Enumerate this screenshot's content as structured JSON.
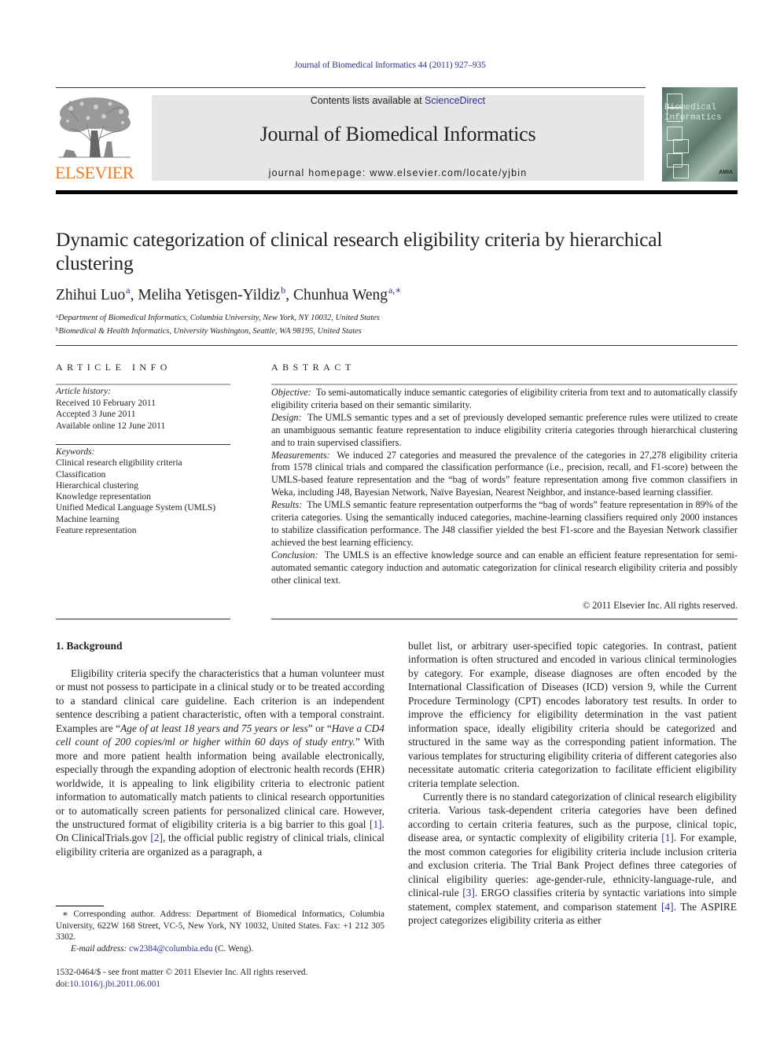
{
  "running_head": "Journal of Biomedical Informatics 44 (2011) 927–935",
  "masthead": {
    "publisher_wordmark": "ELSEVIER",
    "contents_prefix": "Contents lists available at ",
    "contents_link": "ScienceDirect",
    "journal_name": "Journal of Biomedical Informatics",
    "homepage_label": "journal homepage: ",
    "homepage_url": "www.elsevier.com/locate/yjbin",
    "cover_title_line1": "Biomedical",
    "cover_title_line2": "Informatics",
    "cover_publisher": "AMIA"
  },
  "article": {
    "title": "Dynamic categorization of clinical research eligibility criteria by hierarchical clustering",
    "authors": [
      {
        "name": "Zhihui Luo",
        "sup": "a",
        "sep": ", "
      },
      {
        "name": "Meliha Yetisgen-Yildiz",
        "sup": "b",
        "sep": ", "
      },
      {
        "name": "Chunhua Weng",
        "sup": "a,∗",
        "sep": ""
      }
    ],
    "affiliations": [
      {
        "mark": "a",
        "text": "Department of Biomedical Informatics, Columbia University, New York, NY 10032, United States"
      },
      {
        "mark": "b",
        "text": "Biomedical & Health Informatics, University Washington, Seattle, WA 98195, United States"
      }
    ]
  },
  "article_info": {
    "heading": "ARTICLE INFO",
    "history_label": "Article history:",
    "history": [
      "Received 10 February 2011",
      "Accepted 3 June 2011",
      "Available online 12 June 2011"
    ],
    "keywords_label": "Keywords:",
    "keywords": [
      "Clinical research eligibility criteria",
      "Classification",
      "Hierarchical clustering",
      "Knowledge representation",
      "Unified Medical Language System (UMLS)",
      "Machine learning",
      "Feature representation"
    ]
  },
  "abstract": {
    "heading": "ABSTRACT",
    "sections": [
      {
        "label": "Objective:",
        "text": "To semi-automatically induce semantic categories of eligibility criteria from text and to automatically classify eligibility criteria based on their semantic similarity."
      },
      {
        "label": "Design:",
        "text": "The UMLS semantic types and a set of previously developed semantic preference rules were utilized to create an unambiguous semantic feature representation to induce eligibility criteria categories through hierarchical clustering and to train supervised classifiers."
      },
      {
        "label": "Measurements:",
        "text": "We induced 27 categories and measured the prevalence of the categories in 27,278 eligibility criteria from 1578 clinical trials and compared the classification performance (i.e., precision, recall, and F1-score) between the UMLS-based feature representation and the “bag of words” feature representation among five common classifiers in Weka, including J48, Bayesian Network, Naïve Bayesian, Nearest Neighbor, and instance-based learning classifier."
      },
      {
        "label": "Results:",
        "text": "The UMLS semantic feature representation outperforms the “bag of words” feature representation in 89% of the criteria categories. Using the semantically induced categories, machine-learning classifiers required only 2000 instances to stabilize classification performance. The J48 classifier yielded the best F1-score and the Bayesian Network classifier achieved the best learning efficiency."
      },
      {
        "label": "Conclusion:",
        "text": "The UMLS is an effective knowledge source and can enable an efficient feature representation for semi-automated semantic category induction and automatic categorization for clinical research eligibility criteria and possibly other clinical text."
      }
    ],
    "copyright": "© 2011 Elsevier Inc. All rights reserved."
  },
  "body": {
    "section_heading": "1. Background",
    "left_p1_a": "Eligibility criteria specify the characteristics that a human volunteer must or must not possess to participate in a clinical study or to be treated according to a standard clinical care guideline. Each criterion is an independent sentence describing a patient characteristic, often with a temporal constraint. Examples are “",
    "left_p1_ex1": "Age of at least 18 years and 75 years or less",
    "left_p1_b": "” or “",
    "left_p1_ex2": "Have a CD4 cell count of 200 copies/ml or higher within 60 days of study entry.",
    "left_p1_c": "” With more and more patient health information being available electronically, especially through the expanding adoption of electronic health records (EHR) worldwide, it is appealing to link eligibility criteria to electronic patient information to automatically match patients to clinical research opportunities or to automatically screen patients for personalized clinical care. However, the unstructured format of eligibility criteria is a big barrier to this goal ",
    "ref1": "[1]",
    "left_p1_d": ". On ClinicalTrials.gov ",
    "ref2": "[2]",
    "left_p1_e": ", the official public registry of clinical trials, clinical eligibility criteria are organized as a paragraph, a",
    "right_p1": "bullet list, or arbitrary user-specified topic categories. In contrast, patient information is often structured and encoded in various clinical terminologies by category. For example, disease diagnoses are often encoded by the International Classification of Diseases (ICD) version 9, while the Current Procedure Terminology (CPT) encodes laboratory test results. In order to improve the efficiency for eligibility determination in the vast patient information space, ideally eligibility criteria should be categorized and structured in the same way as the corresponding patient information. The various templates for structuring eligibility criteria of different categories also necessitate automatic criteria categorization to facilitate efficient eligibility criteria template selection.",
    "right_p2_a": "Currently there is no standard categorization of clinical research eligibility criteria. Various task-dependent criteria categories have been defined according to certain criteria features, such as the purpose, clinical topic, disease area, or syntactic complexity of eligibility criteria ",
    "right_p2_b": ". For example, the most common categories for eligibility criteria include inclusion criteria and exclusion criteria. The Trial Bank Project defines three categories of clinical eligibility queries: age-gender-rule, ethnicity-language-rule, and clinical-rule ",
    "ref3": "[3]",
    "right_p2_c": ". ERGO classifies criteria by syntactic variations into simple statement, complex statement, and comparison statement ",
    "ref4": "[4]",
    "right_p2_d": ". The ASPIRE project categorizes eligibility criteria as either"
  },
  "footnotes": {
    "corresponding": "∗ Corresponding author. Address: Department of Biomedical Informatics, Columbia University, 622W 168 Street, VC-5, New York, NY 10032, United States. Fax: +1 212 305 3302.",
    "email_label": "E-mail address: ",
    "email": "cw2384@columbia.edu",
    "email_suffix": " (C. Weng).",
    "front_matter": "1532-0464/$ - see front matter © 2011 Elsevier Inc. All rights reserved.",
    "doi_label": "doi:",
    "doi": "10.1016/j.jbi.2011.06.001"
  },
  "colors": {
    "link": "#2e3192",
    "elsevier_orange": "#f47920",
    "banner_gray": "#e6e6e6"
  }
}
